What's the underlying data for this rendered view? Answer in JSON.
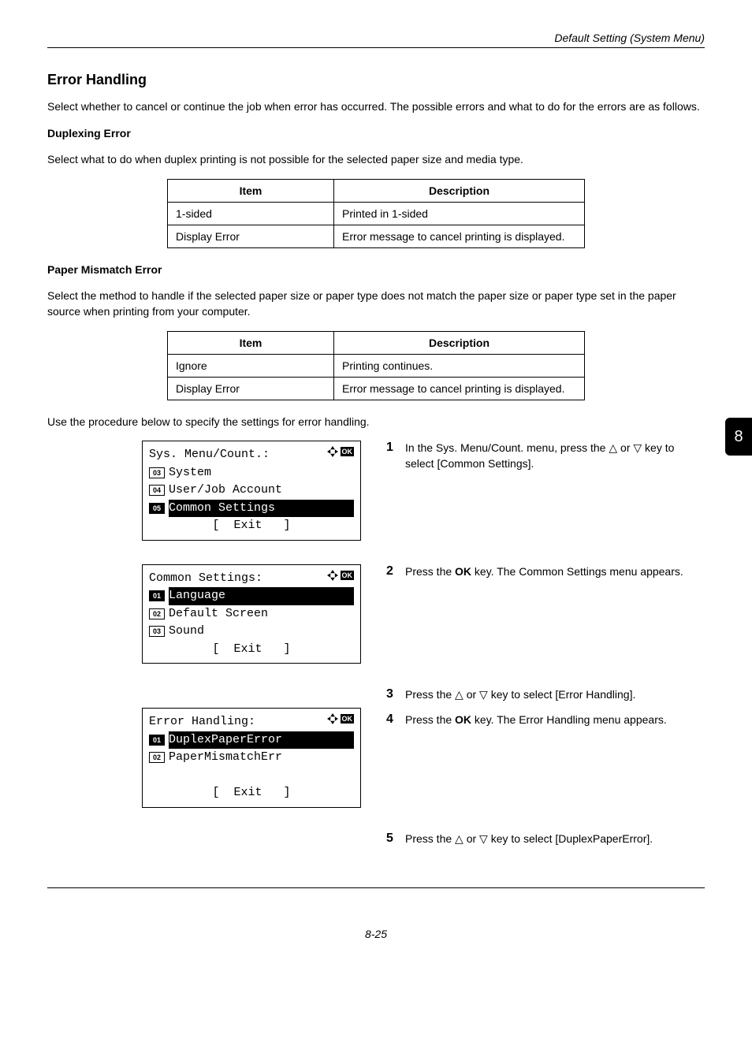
{
  "header": {
    "section": "Default Setting (System Menu)"
  },
  "title": "Error Handling",
  "intro": "Select whether to cancel or continue the job when error has occurred. The possible errors and what to do for the errors are as follows.",
  "sub1": {
    "heading": "Duplexing Error",
    "text": "Select what to do when duplex printing is not possible for the selected paper size and media type."
  },
  "table_headers": {
    "item": "Item",
    "desc": "Description"
  },
  "table1": [
    {
      "item": "1-sided",
      "desc": "Printed in 1-sided"
    },
    {
      "item": "Display Error",
      "desc": "Error message to cancel printing is displayed."
    }
  ],
  "sub2": {
    "heading": "Paper Mismatch Error",
    "text": "Select the method to handle if the selected paper size or paper type does not match the paper size or paper type set in the paper source when printing from your computer."
  },
  "table2": [
    {
      "item": "Ignore",
      "desc": "Printing continues."
    },
    {
      "item": "Display Error",
      "desc": "Error message to cancel printing is displayed."
    }
  ],
  "procedure_intro": "Use the procedure below to specify the settings for error handling.",
  "ok_label": "OK",
  "lcd1": {
    "title": "Sys. Menu/Count.:",
    "rows": [
      {
        "num": "03",
        "label": "System",
        "sel": false
      },
      {
        "num": "04",
        "label": "User/Job Account",
        "sel": false
      },
      {
        "num": "05",
        "label": "Common Settings",
        "sel": true
      }
    ],
    "exit": "[  Exit   ]"
  },
  "lcd2": {
    "title": "Common Settings:",
    "rows": [
      {
        "num": "01",
        "label": "Language",
        "sel": true
      },
      {
        "num": "02",
        "label": "Default Screen",
        "sel": false
      },
      {
        "num": "03",
        "label": "Sound",
        "sel": false
      }
    ],
    "exit": "[  Exit   ]"
  },
  "lcd3": {
    "title": "Error Handling:",
    "rows": [
      {
        "num": "01",
        "label": "DuplexPaperError",
        "sel": true
      },
      {
        "num": "02",
        "label": "PaperMismatchErr",
        "sel": false
      }
    ],
    "exit": "[  Exit   ]"
  },
  "steps": {
    "s1a": "In the Sys. Menu/Count. menu, press the ",
    "s1b": " or ",
    "s1c": " key to select [Common Settings].",
    "s2a": "Press the ",
    "s2b": " key. The Common Settings menu appears.",
    "s3a": "Press the ",
    "s3b": " or ",
    "s3c": " key to select [Error Handling].",
    "s4a": "Press the ",
    "s4b": " key. The Error Handling menu appears.",
    "s5a": "Press the ",
    "s5b": " or ",
    "s5c": " key to select [DuplexPaperError]."
  },
  "ok_key": "OK",
  "side_tab": "8",
  "footer": "8-25"
}
